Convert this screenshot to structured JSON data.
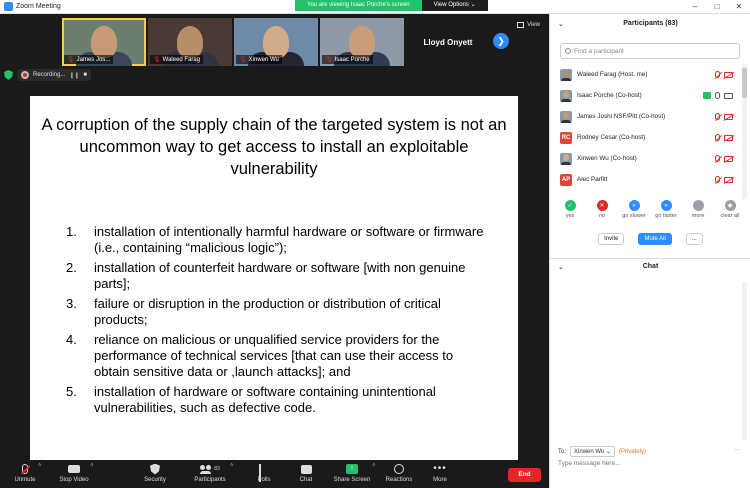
{
  "window": {
    "title": "Zoom Meeting"
  },
  "banner": {
    "viewing_text": "You are viewing Isaac Porche's screen",
    "view_options_label": "View Options ⌄"
  },
  "video_strip": {
    "view_label": "View",
    "thumbs": [
      {
        "name": "James Jos...",
        "skin": "#c59a75",
        "shirt": "#3b4756",
        "bg": "#6a7f6d",
        "active": true
      },
      {
        "name": "Waleed Farag",
        "skin": "#b88d6a",
        "shirt": "#2e3440",
        "bg": "#4a3a36"
      },
      {
        "name": "Xinwen Wu",
        "skin": "#d2ab88",
        "shirt": "#22262e",
        "bg": "#6f8aa6"
      },
      {
        "name": "Isaac Porche",
        "skin": "#c99d7a",
        "shirt": "#2f3b55",
        "bg": "#8e9aa6"
      }
    ],
    "name_only": "Lloyd Onyett"
  },
  "recording": {
    "label": "Recording..."
  },
  "slide": {
    "title": "A corruption of the supply chain of the targeted system is not an uncommon way to get access to install an exploitable vulnerability",
    "items": [
      {
        "num": "1.",
        "text": "installation of intentionally harmful hardware or software or firmware (i.e., containing “malicious logic”);"
      },
      {
        "num": "2.",
        "text": "installation of counterfeit hardware or software [with non genuine parts];"
      },
      {
        "num": "3.",
        "text": "failure or disruption in the production or distribution of critical products;"
      },
      {
        "num": "4.",
        "text": "reliance on malicious or unqualified service providers for the performance of technical services [that can use their access to obtain sensitive data or ,launch attacks]; and"
      },
      {
        "num": "5.",
        "text": "installation of hardware or software containing unintentional vulnerabilities, such as defective code."
      }
    ]
  },
  "participants": {
    "title": "Participants (83)",
    "search_placeholder": "Find a participant",
    "rows": [
      {
        "name": "Waleed Farag (Host, me)",
        "avatar_type": "photo",
        "avatar_color": "#b88d6a",
        "screen": false,
        "mic_on": false,
        "video_on": false
      },
      {
        "name": "Isaac Porche (Co-host)",
        "avatar_type": "photo",
        "avatar_color": "#c99d7a",
        "screen": true,
        "mic_on": true,
        "video_on": true
      },
      {
        "name": "James Joshi NSF/Pitt (Co-host)",
        "avatar_type": "photo",
        "avatar_color": "#c59a75",
        "screen": false,
        "mic_on": false,
        "video_on": false
      },
      {
        "name": "Rodney Cesar (Co-host)",
        "avatar_type": "initials",
        "initials": "RC",
        "avatar_color": "#d8473a",
        "screen": false,
        "mic_on": false,
        "video_on": false
      },
      {
        "name": "Xinwen Wu (Co-host)",
        "avatar_type": "photo",
        "avatar_color": "#d2ab88",
        "screen": false,
        "mic_on": false,
        "video_on": false
      },
      {
        "name": "Alec Parfitt",
        "avatar_type": "initials",
        "initials": "AP",
        "avatar_color": "#d8473a",
        "screen": false,
        "mic_on": false,
        "video_on": false
      }
    ],
    "reactions": [
      {
        "label": "yes",
        "symbol": "✓",
        "color": "#23c16b"
      },
      {
        "label": "no",
        "symbol": "✕",
        "color": "#e02828"
      },
      {
        "label": "go slower",
        "symbol": "«",
        "color": "#2d8cff"
      },
      {
        "label": "go faster",
        "symbol": "»",
        "color": "#2d8cff"
      },
      {
        "label": "more",
        "symbol": "",
        "color": "#9aa0a6"
      },
      {
        "label": "clear all",
        "symbol": "◆",
        "color": "#9aa0a6"
      }
    ],
    "invite_label": "Invite",
    "mute_all_label": "Mute All",
    "more_label": "..."
  },
  "chat": {
    "title": "Chat",
    "to_label": "To:",
    "recipient": "Xinwen Wu ⌄",
    "privately": "(Privately)",
    "input_placeholder": "Type message here...",
    "more_label": "..."
  },
  "toolbar": {
    "unmute": "Unmute",
    "stop_video": "Stop Video",
    "security": "Security",
    "participants": "Participants",
    "participants_count": "83",
    "polls": "Polls",
    "chat": "Chat",
    "share_screen": "Share Screen",
    "reactions": "Reactions",
    "more": "More",
    "end": "End"
  },
  "colors": {
    "accent": "#2d8cff",
    "green": "#23c16b",
    "red": "#e02828"
  }
}
